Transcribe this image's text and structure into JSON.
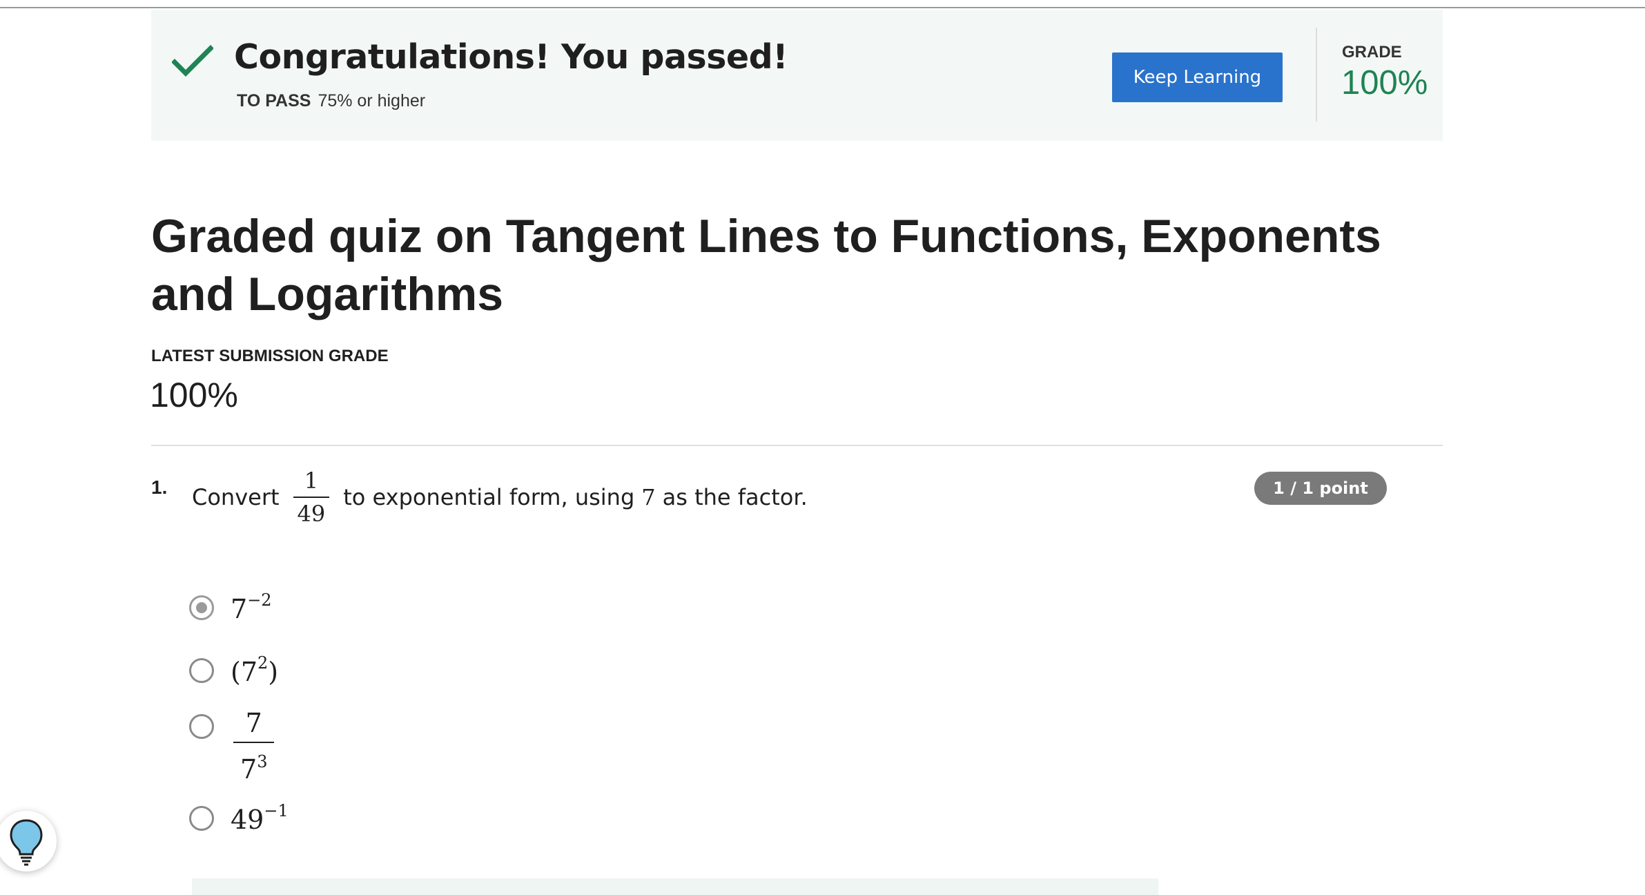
{
  "banner": {
    "title": "Congratulations! You passed!",
    "to_pass_label": "TO PASS",
    "to_pass_value": "75% or higher",
    "keep_learning_label": "Keep Learning",
    "grade_label": "GRADE",
    "grade_value": "100%",
    "icon": "checkmark-icon"
  },
  "quiz": {
    "title": "Graded quiz on Tangent Lines to Functions, Exponents and Logarithms",
    "latest_submission_label": "LATEST SUBMISSION GRADE",
    "latest_submission_value": "100%"
  },
  "question": {
    "number": "1.",
    "text_before": "Convert",
    "fraction_numerator": "1",
    "fraction_denominator": "49",
    "text_middle": "to exponential form, using",
    "factor": "7",
    "text_after": "as the factor.",
    "points": "1 / 1 point",
    "options": [
      {
        "base": "7",
        "exponent": "−2",
        "selected": true
      },
      {
        "open": "(",
        "base": "7",
        "exponent": "2",
        "close": ")",
        "selected": false
      },
      {
        "numerator": "7",
        "den_base": "7",
        "den_exponent": "3",
        "selected": false
      },
      {
        "base": "49",
        "exponent": "−1",
        "selected": false
      }
    ]
  },
  "colors": {
    "banner_bg": "#f3f8f6",
    "accent_green": "#1f8354",
    "button_blue": "#2a73cc",
    "badge_gray": "#7a7a7a"
  },
  "help": {
    "icon": "lightbulb-icon"
  }
}
